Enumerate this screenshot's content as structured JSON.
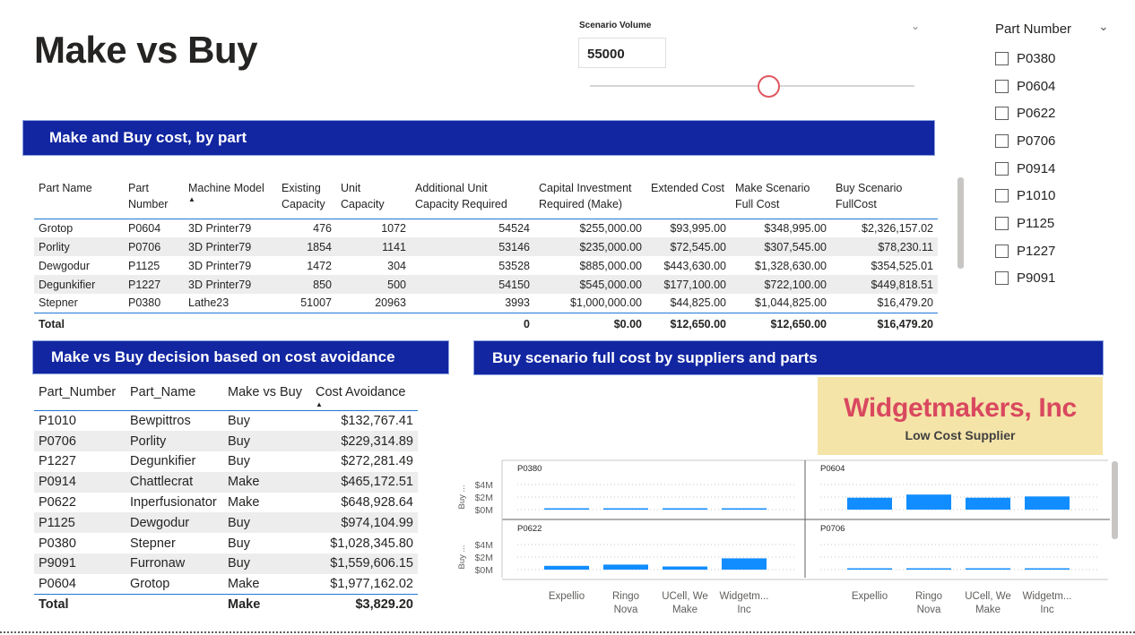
{
  "page": {
    "title": "Make vs Buy"
  },
  "scenario": {
    "label": "Scenario Volume",
    "value": "55000",
    "slider_fraction": 0.55
  },
  "part_slicer": {
    "title": "Part Number",
    "items": [
      "P0380",
      "P0604",
      "P0622",
      "P0706",
      "P0914",
      "P1010",
      "P1125",
      "P1227",
      "P9091"
    ]
  },
  "main_table": {
    "title": "Make and Buy cost, by part",
    "headers": [
      "Part Name",
      "Part Number",
      "Machine Model",
      "Existing Capacity",
      "Unit Capacity",
      "Additional Unit Capacity Required",
      "Capital Investment Required (Make)",
      "Extended Cost",
      "Make Scenario Full Cost",
      "Buy Scenario FullCost"
    ],
    "rows": [
      [
        "Grotop",
        "P0604",
        "3D Printer79",
        "476",
        "1072",
        "54524",
        "$255,000.00",
        "$93,995.00",
        "$348,995.00",
        "$2,326,157.02"
      ],
      [
        "Porlity",
        "P0706",
        "3D Printer79",
        "1854",
        "1141",
        "53146",
        "$235,000.00",
        "$72,545.00",
        "$307,545.00",
        "$78,230.11"
      ],
      [
        "Dewgodur",
        "P1125",
        "3D Printer79",
        "1472",
        "304",
        "53528",
        "$885,000.00",
        "$443,630.00",
        "$1,328,630.00",
        "$354,525.01"
      ],
      [
        "Degunkifier",
        "P1227",
        "3D Printer79",
        "850",
        "500",
        "54150",
        "$545,000.00",
        "$177,100.00",
        "$722,100.00",
        "$449,818.51"
      ],
      [
        "Stepner",
        "P0380",
        "Lathe23",
        "51007",
        "20963",
        "3993",
        "$1,000,000.00",
        "$44,825.00",
        "$1,044,825.00",
        "$16,479.20"
      ]
    ],
    "total": [
      "Total",
      "",
      "",
      "",
      "",
      "0",
      "$0.00",
      "$12,650.00",
      "$12,650.00",
      "$16,479.20"
    ]
  },
  "avoidance_table": {
    "title": "Make vs Buy decision based on cost avoidance",
    "headers": [
      "Part_Number",
      "Part_Name",
      "Make vs Buy",
      "Cost Avoidance"
    ],
    "rows": [
      [
        "P1010",
        "Bewpittros",
        "Buy",
        "$132,767.41"
      ],
      [
        "P0706",
        "Porlity",
        "Buy",
        "$229,314.89"
      ],
      [
        "P1227",
        "Degunkifier",
        "Buy",
        "$272,281.49"
      ],
      [
        "P0914",
        "Chattlecrat",
        "Make",
        "$465,172.51"
      ],
      [
        "P0622",
        "Inperfusionator",
        "Make",
        "$648,928.64"
      ],
      [
        "P1125",
        "Dewgodur",
        "Buy",
        "$974,104.99"
      ],
      [
        "P0380",
        "Stepner",
        "Buy",
        "$1,028,345.80"
      ],
      [
        "P9091",
        "Furronaw",
        "Buy",
        "$1,559,606.15"
      ],
      [
        "P0604",
        "Grotop",
        "Make",
        "$1,977,162.02"
      ]
    ],
    "total": [
      "Total",
      "",
      "Make",
      "$3,829.20"
    ]
  },
  "chart_section": {
    "title": "Buy scenario full cost by suppliers and parts",
    "callout_title": "Widgetmakers, Inc",
    "callout_subtitle": "Low Cost Supplier"
  },
  "chart_data": {
    "type": "bar",
    "layout": "small-multiples 2x2",
    "ylabel": "Buy ...",
    "yticks": [
      "$0M",
      "$2M",
      "$4M"
    ],
    "ylim": [
      0,
      4
    ],
    "categories": [
      [
        "Expellio"
      ],
      [
        "Ringo",
        "Nova"
      ],
      [
        "UCell, We",
        "Make"
      ],
      [
        "Widgetm...",
        "Inc"
      ]
    ],
    "bar_color": "#118dff",
    "panels": [
      {
        "part": "P0380",
        "values": [
          0.1,
          0.1,
          0.1,
          0.1
        ]
      },
      {
        "part": "P0604",
        "values": [
          1.9,
          2.4,
          1.9,
          2.1
        ]
      },
      {
        "part": "P0622",
        "values": [
          0.6,
          0.8,
          0.5,
          1.8
        ]
      },
      {
        "part": "P0706",
        "values": [
          0.1,
          0.1,
          0.1,
          0.1
        ]
      }
    ]
  }
}
